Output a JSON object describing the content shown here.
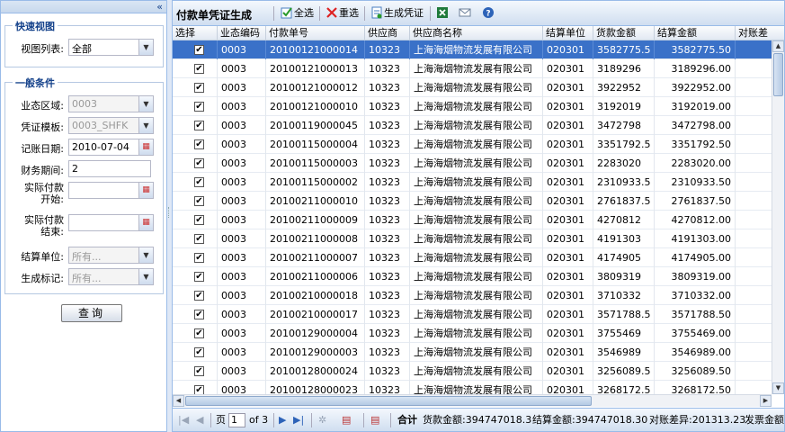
{
  "left": {
    "collapse_glyph": "«",
    "quick_view": {
      "legend": "快速视图",
      "view_list_label": "视图列表:",
      "view_list_value": "全部"
    },
    "conditions": {
      "legend": "一般条件",
      "business_area_label": "业态区域:",
      "business_area_value": "0003",
      "voucher_template_label": "凭证模板:",
      "voucher_template_value": "0003_SHFK",
      "posting_date_label": "记账日期:",
      "posting_date_value": "2010-07-04",
      "fiscal_period_label": "财务期间:",
      "fiscal_period_value": "2",
      "actual_pay_start_label_1": "实际付款",
      "actual_pay_start_label_2": "开始:",
      "actual_pay_end_label_1": "实际付款",
      "actual_pay_end_label_2": "结束:",
      "settle_unit_label": "结算单位:",
      "settle_unit_value": "所有...",
      "gen_flag_label": "生成标记:",
      "gen_flag_value": "所有..."
    },
    "query_button": "查询"
  },
  "toolbar": {
    "title": "付款单凭证生成",
    "select_all": "全选",
    "reselect": "重选",
    "generate": "生成凭证"
  },
  "grid": {
    "columns": [
      "选择",
      "业态编码",
      "付款单号",
      "供应商",
      "供应商名称",
      "结算单位",
      "货款金额",
      "结算金额",
      "对账差"
    ],
    "rows": [
      {
        "checked": "✔",
        "biz": "0003",
        "no": "20100121000014",
        "sup": "10323",
        "name": "上海海烟物流发展有限公司",
        "unit": "020301",
        "amt": "3582775.5",
        "settle": "3582775.50"
      },
      {
        "checked": "✔",
        "biz": "0003",
        "no": "20100121000013",
        "sup": "10323",
        "name": "上海海烟物流发展有限公司",
        "unit": "020301",
        "amt": "3189296",
        "settle": "3189296.00"
      },
      {
        "checked": "✔",
        "biz": "0003",
        "no": "20100121000012",
        "sup": "10323",
        "name": "上海海烟物流发展有限公司",
        "unit": "020301",
        "amt": "3922952",
        "settle": "3922952.00"
      },
      {
        "checked": "✔",
        "biz": "0003",
        "no": "20100121000010",
        "sup": "10323",
        "name": "上海海烟物流发展有限公司",
        "unit": "020301",
        "amt": "3192019",
        "settle": "3192019.00"
      },
      {
        "checked": "✔",
        "biz": "0003",
        "no": "20100119000045",
        "sup": "10323",
        "name": "上海海烟物流发展有限公司",
        "unit": "020301",
        "amt": "3472798",
        "settle": "3472798.00"
      },
      {
        "checked": "✔",
        "biz": "0003",
        "no": "20100115000004",
        "sup": "10323",
        "name": "上海海烟物流发展有限公司",
        "unit": "020301",
        "amt": "3351792.5",
        "settle": "3351792.50"
      },
      {
        "checked": "✔",
        "biz": "0003",
        "no": "20100115000003",
        "sup": "10323",
        "name": "上海海烟物流发展有限公司",
        "unit": "020301",
        "amt": "2283020",
        "settle": "2283020.00"
      },
      {
        "checked": "✔",
        "biz": "0003",
        "no": "20100115000002",
        "sup": "10323",
        "name": "上海海烟物流发展有限公司",
        "unit": "020301",
        "amt": "2310933.5",
        "settle": "2310933.50"
      },
      {
        "checked": "✔",
        "biz": "0003",
        "no": "20100211000010",
        "sup": "10323",
        "name": "上海海烟物流发展有限公司",
        "unit": "020301",
        "amt": "2761837.5",
        "settle": "2761837.50"
      },
      {
        "checked": "✔",
        "biz": "0003",
        "no": "20100211000009",
        "sup": "10323",
        "name": "上海海烟物流发展有限公司",
        "unit": "020301",
        "amt": "4270812",
        "settle": "4270812.00"
      },
      {
        "checked": "✔",
        "biz": "0003",
        "no": "20100211000008",
        "sup": "10323",
        "name": "上海海烟物流发展有限公司",
        "unit": "020301",
        "amt": "4191303",
        "settle": "4191303.00"
      },
      {
        "checked": "✔",
        "biz": "0003",
        "no": "20100211000007",
        "sup": "10323",
        "name": "上海海烟物流发展有限公司",
        "unit": "020301",
        "amt": "4174905",
        "settle": "4174905.00"
      },
      {
        "checked": "✔",
        "biz": "0003",
        "no": "20100211000006",
        "sup": "10323",
        "name": "上海海烟物流发展有限公司",
        "unit": "020301",
        "amt": "3809319",
        "settle": "3809319.00"
      },
      {
        "checked": "✔",
        "biz": "0003",
        "no": "20100210000018",
        "sup": "10323",
        "name": "上海海烟物流发展有限公司",
        "unit": "020301",
        "amt": "3710332",
        "settle": "3710332.00"
      },
      {
        "checked": "✔",
        "biz": "0003",
        "no": "20100210000017",
        "sup": "10323",
        "name": "上海海烟物流发展有限公司",
        "unit": "020301",
        "amt": "3571788.5",
        "settle": "3571788.50"
      },
      {
        "checked": "✔",
        "biz": "0003",
        "no": "20100129000004",
        "sup": "10323",
        "name": "上海海烟物流发展有限公司",
        "unit": "020301",
        "amt": "3755469",
        "settle": "3755469.00"
      },
      {
        "checked": "✔",
        "biz": "0003",
        "no": "20100129000003",
        "sup": "10323",
        "name": "上海海烟物流发展有限公司",
        "unit": "020301",
        "amt": "3546989",
        "settle": "3546989.00"
      },
      {
        "checked": "✔",
        "biz": "0003",
        "no": "20100128000024",
        "sup": "10323",
        "name": "上海海烟物流发展有限公司",
        "unit": "020301",
        "amt": "3256089.5",
        "settle": "3256089.50"
      },
      {
        "checked": "✔",
        "biz": "0003",
        "no": "20100128000023",
        "sup": "10323",
        "name": "上海海烟物流发展有限公司",
        "unit": "020301",
        "amt": "3268172.5",
        "settle": "3268172.50"
      }
    ]
  },
  "pager": {
    "page_label": "页",
    "current_page": "1",
    "of_label": "of 3",
    "total_label": "合计",
    "goods_total": "货款金额:394747018.3",
    "settle_total": "结算金额:394747018.30",
    "diff_total": "对账差异:201313.23",
    "invoice_total": "发票金额"
  },
  "colors": {
    "selected_row": "#3a71c8",
    "panel_border": "#99bbe8",
    "legend_text": "#15428b"
  }
}
